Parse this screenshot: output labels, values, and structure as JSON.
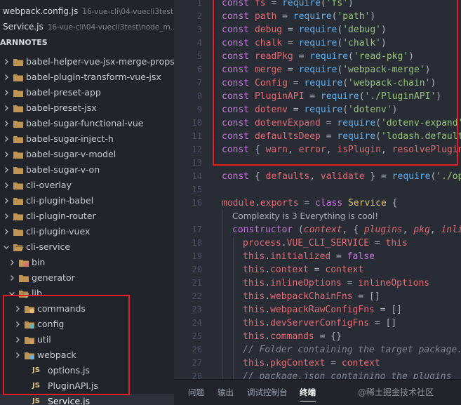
{
  "open_editors": [
    {
      "name": "webpack.config.js",
      "description": "16-vue-cli\\04-vuecli3test"
    },
    {
      "name": "Service.js",
      "description": "16-vue-cli\\04-vuecli3test\\node_m..."
    }
  ],
  "explorer": {
    "section_title": "ARNNOTES",
    "items": [
      {
        "label": "babel-helper-vue-jsx-merge-props",
        "type": "folder",
        "state": "collapsed",
        "depth": 0
      },
      {
        "label": "babel-plugin-transform-vue-jsx",
        "type": "folder",
        "state": "collapsed",
        "depth": 0
      },
      {
        "label": "babel-preset-app",
        "type": "folder",
        "state": "collapsed",
        "depth": 0
      },
      {
        "label": "babel-preset-jsx",
        "type": "folder",
        "state": "collapsed",
        "depth": 0
      },
      {
        "label": "babel-sugar-functional-vue",
        "type": "folder",
        "state": "collapsed",
        "depth": 0
      },
      {
        "label": "babel-sugar-inject-h",
        "type": "folder",
        "state": "collapsed",
        "depth": 0
      },
      {
        "label": "babel-sugar-v-model",
        "type": "folder",
        "state": "collapsed",
        "depth": 0
      },
      {
        "label": "babel-sugar-v-on",
        "type": "folder",
        "state": "collapsed",
        "depth": 0
      },
      {
        "label": "cli-overlay",
        "type": "folder",
        "state": "collapsed",
        "depth": 0
      },
      {
        "label": "cli-plugin-babel",
        "type": "folder",
        "state": "collapsed",
        "depth": 0
      },
      {
        "label": "cli-plugin-router",
        "type": "folder",
        "state": "collapsed",
        "depth": 0
      },
      {
        "label": "cli-plugin-vuex",
        "type": "folder",
        "state": "collapsed",
        "depth": 0
      },
      {
        "label": "cli-service",
        "type": "folder",
        "state": "expanded",
        "depth": 0
      },
      {
        "label": "bin",
        "type": "folder-bin",
        "state": "collapsed",
        "depth": 1
      },
      {
        "label": "generator",
        "type": "folder",
        "state": "collapsed",
        "depth": 1
      },
      {
        "label": "lib",
        "type": "folder-lib",
        "state": "expanded",
        "depth": 1
      },
      {
        "label": "commands",
        "type": "folder-commands",
        "state": "collapsed",
        "depth": 2
      },
      {
        "label": "config",
        "type": "folder-config",
        "state": "collapsed",
        "depth": 2
      },
      {
        "label": "util",
        "type": "folder-util",
        "state": "collapsed",
        "depth": 2
      },
      {
        "label": "webpack",
        "type": "folder-webpack",
        "state": "collapsed",
        "depth": 2
      },
      {
        "label": "options.js",
        "type": "js",
        "state": "none",
        "depth": 2
      },
      {
        "label": "PluginAPI.js",
        "type": "js",
        "state": "none",
        "depth": 2
      },
      {
        "label": "Service.js",
        "type": "js",
        "state": "active",
        "depth": 2
      }
    ]
  },
  "js_badge": "JS",
  "editor": {
    "lines": [
      {
        "num": "1",
        "indent": 0,
        "tokens": [
          [
            "kw",
            "const"
          ],
          [
            "pn",
            " "
          ],
          [
            "vr",
            "fs"
          ],
          [
            "pn",
            " = "
          ],
          [
            "fn",
            "require"
          ],
          [
            "pn",
            "("
          ],
          [
            "st",
            "'fs'"
          ],
          [
            "pn",
            ")"
          ]
        ]
      },
      {
        "num": "2",
        "indent": 0,
        "tokens": [
          [
            "kw",
            "const"
          ],
          [
            "pn",
            " "
          ],
          [
            "vr",
            "path"
          ],
          [
            "pn",
            " = "
          ],
          [
            "fn",
            "require"
          ],
          [
            "pn",
            "("
          ],
          [
            "st",
            "'path'"
          ],
          [
            "pn",
            ")"
          ]
        ]
      },
      {
        "num": "3",
        "indent": 0,
        "tokens": [
          [
            "kw",
            "const"
          ],
          [
            "pn",
            " "
          ],
          [
            "vr",
            "debug"
          ],
          [
            "pn",
            " = "
          ],
          [
            "fn",
            "require"
          ],
          [
            "pn",
            "("
          ],
          [
            "st",
            "'debug'"
          ],
          [
            "pn",
            ")"
          ]
        ]
      },
      {
        "num": "4",
        "indent": 0,
        "tokens": [
          [
            "kw",
            "const"
          ],
          [
            "pn",
            " "
          ],
          [
            "vr",
            "chalk"
          ],
          [
            "pn",
            " = "
          ],
          [
            "fn",
            "require"
          ],
          [
            "pn",
            "("
          ],
          [
            "st",
            "'chalk'"
          ],
          [
            "pn",
            ")"
          ]
        ]
      },
      {
        "num": "5",
        "indent": 0,
        "tokens": [
          [
            "kw",
            "const"
          ],
          [
            "pn",
            " "
          ],
          [
            "vr",
            "readPkg"
          ],
          [
            "pn",
            " = "
          ],
          [
            "fn",
            "require"
          ],
          [
            "pn",
            "("
          ],
          [
            "st",
            "'read-pkg'"
          ],
          [
            "pn",
            ")"
          ]
        ]
      },
      {
        "num": "6",
        "indent": 0,
        "tokens": [
          [
            "kw",
            "const"
          ],
          [
            "pn",
            " "
          ],
          [
            "vr",
            "merge"
          ],
          [
            "pn",
            " = "
          ],
          [
            "fn",
            "require"
          ],
          [
            "pn",
            "("
          ],
          [
            "st",
            "'webpack-merge'"
          ],
          [
            "pn",
            ")"
          ]
        ]
      },
      {
        "num": "7",
        "indent": 0,
        "tokens": [
          [
            "kw",
            "const"
          ],
          [
            "pn",
            " "
          ],
          [
            "vr",
            "Config"
          ],
          [
            "pn",
            " = "
          ],
          [
            "fn",
            "require"
          ],
          [
            "pn",
            "("
          ],
          [
            "st",
            "'webpack-chain'"
          ],
          [
            "pn",
            ")"
          ]
        ]
      },
      {
        "num": "8",
        "indent": 0,
        "tokens": [
          [
            "kw",
            "const"
          ],
          [
            "pn",
            " "
          ],
          [
            "vr",
            "PluginAPI"
          ],
          [
            "pn",
            " = "
          ],
          [
            "fn",
            "require"
          ],
          [
            "pn",
            "("
          ],
          [
            "st",
            "'./PluginAPI'"
          ],
          [
            "pn",
            ")"
          ]
        ]
      },
      {
        "num": "9",
        "indent": 0,
        "tokens": [
          [
            "kw",
            "const"
          ],
          [
            "pn",
            " "
          ],
          [
            "vr",
            "dotenv"
          ],
          [
            "pn",
            " = "
          ],
          [
            "fn",
            "require"
          ],
          [
            "pn",
            "("
          ],
          [
            "st",
            "'dotenv'"
          ],
          [
            "pn",
            ")"
          ]
        ]
      },
      {
        "num": "10",
        "indent": 0,
        "tokens": [
          [
            "kw",
            "const"
          ],
          [
            "pn",
            " "
          ],
          [
            "vr",
            "dotenvExpand"
          ],
          [
            "pn",
            " = "
          ],
          [
            "fn",
            "require"
          ],
          [
            "pn",
            "("
          ],
          [
            "st",
            "'dotenv-expand'"
          ],
          [
            "pn",
            ")"
          ]
        ]
      },
      {
        "num": "11",
        "indent": 0,
        "tokens": [
          [
            "kw",
            "const"
          ],
          [
            "pn",
            " "
          ],
          [
            "vr",
            "defaultsDeep"
          ],
          [
            "pn",
            " = "
          ],
          [
            "fn",
            "require"
          ],
          [
            "pn",
            "("
          ],
          [
            "st",
            "'lodash.defaultsdeep'"
          ],
          [
            "pn",
            ")"
          ]
        ]
      },
      {
        "num": "12",
        "indent": 0,
        "tokens": [
          [
            "kw",
            "const"
          ],
          [
            "pn",
            " { "
          ],
          [
            "vr",
            "warn"
          ],
          [
            "pn",
            ", "
          ],
          [
            "vr",
            "error"
          ],
          [
            "pn",
            ", "
          ],
          [
            "vr",
            "isPlugin"
          ],
          [
            "pn",
            ", "
          ],
          [
            "vr",
            "resolvePluginId"
          ],
          [
            "pn",
            " }"
          ]
        ]
      },
      {
        "num": "13",
        "indent": 0,
        "tokens": []
      },
      {
        "num": "14",
        "indent": 0,
        "tokens": [
          [
            "kw",
            "const"
          ],
          [
            "pn",
            " { "
          ],
          [
            "vr",
            "defaults"
          ],
          [
            "pn",
            ", "
          ],
          [
            "vr",
            "validate"
          ],
          [
            "pn",
            " } = "
          ],
          [
            "fn",
            "require"
          ],
          [
            "pn",
            "("
          ],
          [
            "st",
            "'./options'"
          ],
          [
            "pn",
            ")"
          ]
        ]
      },
      {
        "num": "15",
        "indent": 0,
        "tokens": []
      },
      {
        "num": "16",
        "indent": 0,
        "tokens": [
          [
            "vr",
            "module"
          ],
          [
            "pn",
            "."
          ],
          [
            "vr",
            "exports"
          ],
          [
            "pn",
            " = "
          ],
          [
            "kw",
            "class"
          ],
          [
            "pn",
            " "
          ],
          [
            "cl",
            "Service"
          ],
          [
            "pn",
            " {"
          ]
        ]
      },
      {
        "num": "",
        "indent": 1,
        "codelens": "Complexity is 3 Everything is cool!",
        "tokens": []
      },
      {
        "num": "17",
        "indent": 1,
        "tokens": [
          [
            "kw",
            "constructor"
          ],
          [
            "pn",
            " ("
          ],
          [
            "pa",
            "context"
          ],
          [
            "pn",
            ", { "
          ],
          [
            "pa",
            "plugins"
          ],
          [
            "pn",
            ", "
          ],
          [
            "pa",
            "pkg"
          ],
          [
            "pn",
            ", "
          ],
          [
            "pa",
            "inlineOptions"
          ],
          [
            "pn",
            " } = {}) {"
          ]
        ]
      },
      {
        "num": "18",
        "indent": 2,
        "tokens": [
          [
            "vr",
            "process"
          ],
          [
            "pn",
            "."
          ],
          [
            "vr",
            "VUE_CLI_SERVICE"
          ],
          [
            "pn",
            " = "
          ],
          [
            "vr",
            "this"
          ]
        ]
      },
      {
        "num": "19",
        "indent": 2,
        "tokens": [
          [
            "vr",
            "this"
          ],
          [
            "pn",
            "."
          ],
          [
            "vr",
            "initialized"
          ],
          [
            "pn",
            " = "
          ],
          [
            "kw",
            "false"
          ]
        ]
      },
      {
        "num": "20",
        "indent": 2,
        "tokens": [
          [
            "vr",
            "this"
          ],
          [
            "pn",
            "."
          ],
          [
            "vr",
            "context"
          ],
          [
            "pn",
            " = "
          ],
          [
            "vr",
            "context"
          ]
        ]
      },
      {
        "num": "21",
        "indent": 2,
        "tokens": [
          [
            "vr",
            "this"
          ],
          [
            "pn",
            "."
          ],
          [
            "vr",
            "inlineOptions"
          ],
          [
            "pn",
            " = "
          ],
          [
            "vr",
            "inlineOptions"
          ]
        ]
      },
      {
        "num": "22",
        "indent": 2,
        "tokens": [
          [
            "vr",
            "this"
          ],
          [
            "pn",
            "."
          ],
          [
            "vr",
            "webpackChainFns"
          ],
          [
            "pn",
            " = []"
          ]
        ]
      },
      {
        "num": "23",
        "indent": 2,
        "tokens": [
          [
            "vr",
            "this"
          ],
          [
            "pn",
            "."
          ],
          [
            "vr",
            "webpackRawConfigFns"
          ],
          [
            "pn",
            " = []"
          ]
        ]
      },
      {
        "num": "24",
        "indent": 2,
        "tokens": [
          [
            "vr",
            "this"
          ],
          [
            "pn",
            "."
          ],
          [
            "vr",
            "devServerConfigFns"
          ],
          [
            "pn",
            " = []"
          ]
        ]
      },
      {
        "num": "25",
        "indent": 2,
        "tokens": [
          [
            "vr",
            "this"
          ],
          [
            "pn",
            "."
          ],
          [
            "vr",
            "commands"
          ],
          [
            "pn",
            " = {}"
          ]
        ]
      },
      {
        "num": "26",
        "indent": 2,
        "tokens": [
          [
            "cm",
            "// Folder containing the target package.json for plugins"
          ]
        ]
      },
      {
        "num": "27",
        "indent": 2,
        "tokens": [
          [
            "vr",
            "this"
          ],
          [
            "pn",
            "."
          ],
          [
            "vr",
            "pkgContext"
          ],
          [
            "pn",
            " = "
          ],
          [
            "vr",
            "context"
          ]
        ]
      },
      {
        "num": "28",
        "indent": 2,
        "tokens": [
          [
            "cm",
            "// package.json containing the plugins"
          ]
        ]
      }
    ]
  },
  "panel": {
    "tabs": [
      {
        "label": "问题",
        "active": false
      },
      {
        "label": "输出",
        "active": false
      },
      {
        "label": "调试控制台",
        "active": false
      },
      {
        "label": "终端",
        "active": true
      }
    ],
    "watermark": "@稀土掘金技术社区"
  },
  "colors": {
    "sidebar_bg": "#21252b",
    "editor_bg": "#282c34",
    "highlight_box": "#e51c23",
    "folder": "#c09553"
  }
}
